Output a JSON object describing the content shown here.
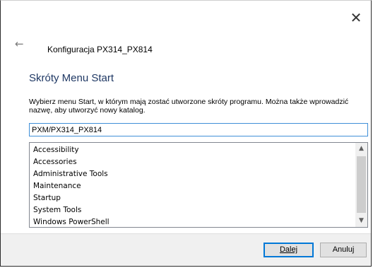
{
  "window": {
    "title": "Konfiguracja PX314_PX814",
    "close_glyph": "✕",
    "back_glyph": "←"
  },
  "page": {
    "heading": "Skróty Menu Start",
    "instructions": "Wybierz menu Start, w którym mają zostać utworzone skróty programu. Można także wprowadzić nazwę, aby utworzyć nowy katalog."
  },
  "folder_input": {
    "value": "PXM/PX314_PX814"
  },
  "folder_list": {
    "items": [
      "Accessibility",
      "Accessories",
      "Administrative Tools",
      "Maintenance",
      "Startup",
      "System Tools",
      "Windows PowerShell"
    ],
    "scroll_up_glyph": "▲",
    "scroll_down_glyph": "▼"
  },
  "buttons": {
    "next_label": "Dalej",
    "cancel_label": "Anuluj"
  },
  "icons": {
    "close": "close-icon",
    "back": "back-arrow-icon",
    "scroll_up": "chevron-up-icon",
    "scroll_down": "chevron-down-icon"
  },
  "colors": {
    "heading": "#1f3864",
    "input_border": "#3f8fd8",
    "default_button_border": "#0078d7",
    "footer_background": "#f0f0f0"
  }
}
